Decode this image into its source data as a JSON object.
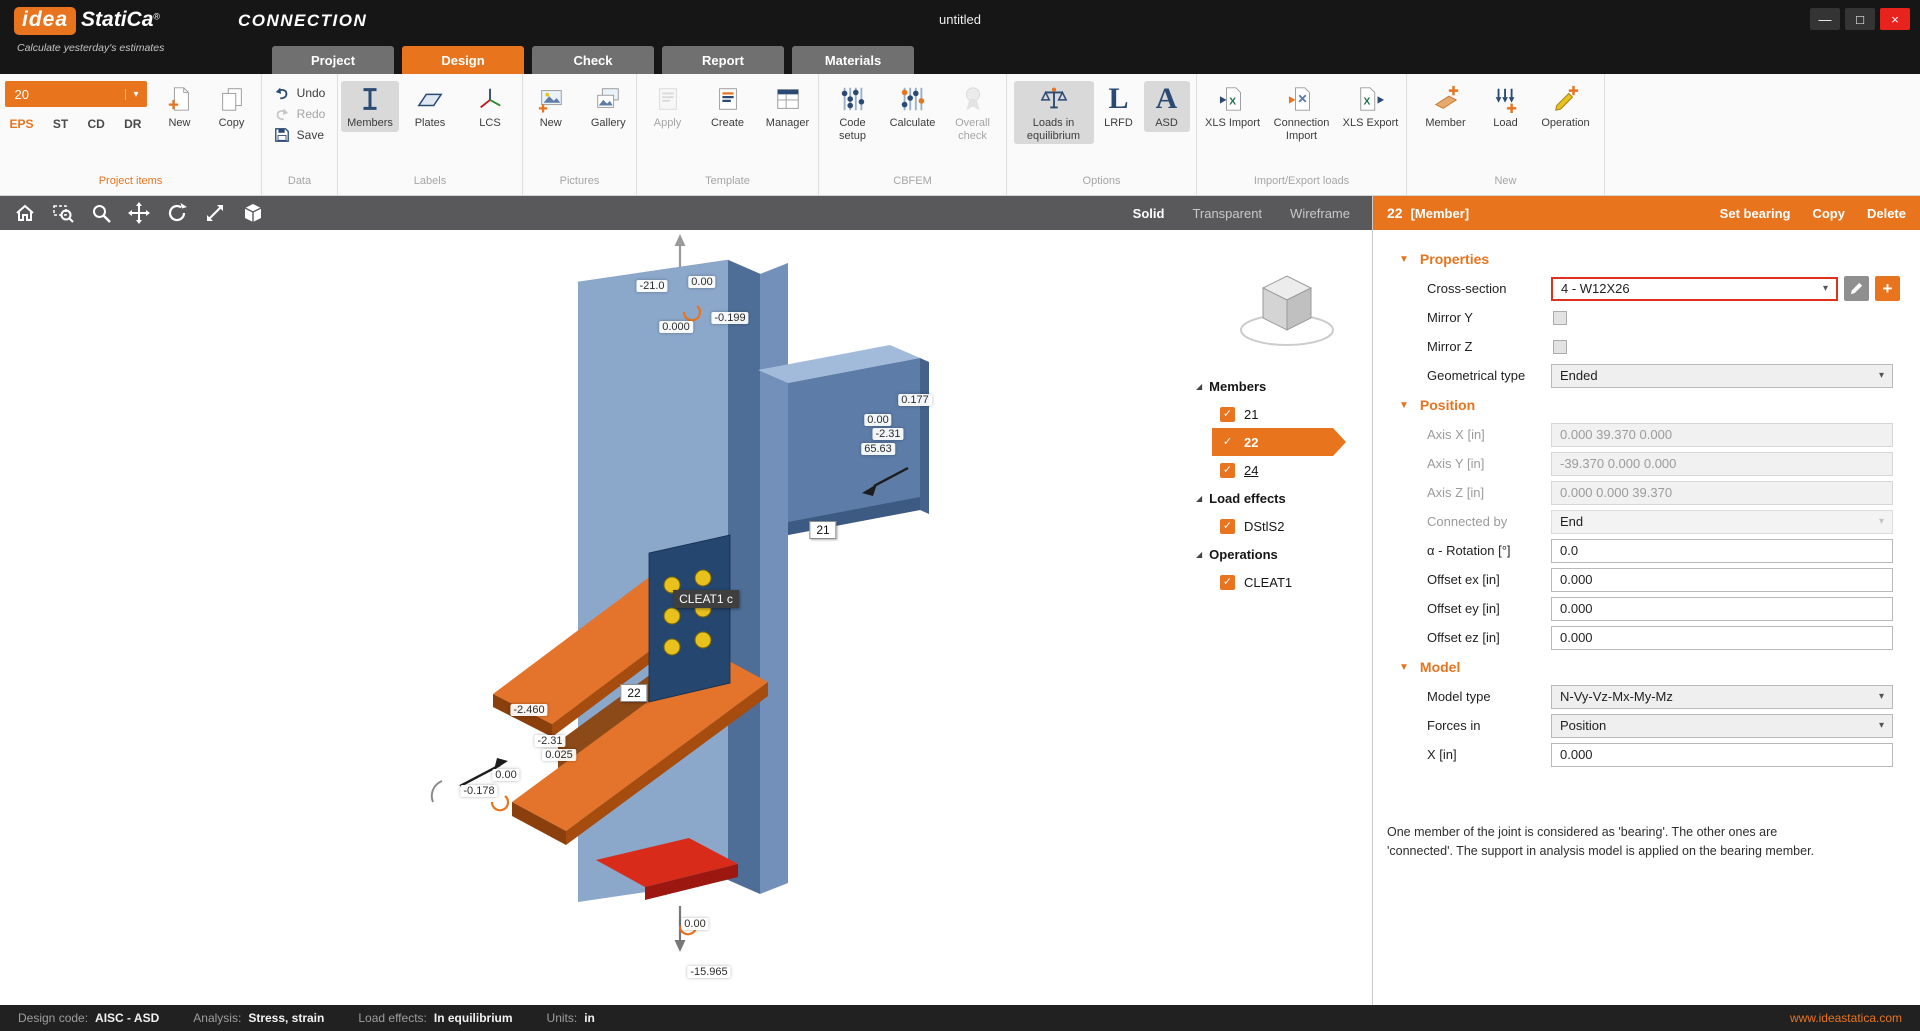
{
  "icons": {
    "check": "✓",
    "expander": "◢",
    "chevron": "▾",
    "section_arrow": "▼",
    "plus": "+",
    "minimize": "—",
    "maximize": "□",
    "close": "×"
  },
  "titlebar": {
    "logo_idea": "idea",
    "logo_statica": "StatiCa",
    "logo_reg": "®",
    "app_name": "CONNECTION",
    "tagline": "Calculate yesterday's estimates",
    "document_title": "untitled"
  },
  "tabs": [
    {
      "label": "Project"
    },
    {
      "label": "Design"
    },
    {
      "label": "Check"
    },
    {
      "label": "Report"
    },
    {
      "label": "Materials"
    }
  ],
  "ribbon": {
    "project_items": {
      "group_label": "Project items",
      "selector_value": "20",
      "codes": [
        "EPS",
        "ST",
        "CD",
        "DR"
      ],
      "new_label": "New",
      "copy_label": "Copy"
    },
    "data": {
      "group_label": "Data",
      "undo": "Undo",
      "redo": "Redo",
      "save": "Save"
    },
    "labels": {
      "group_label": "Labels",
      "members": "Members",
      "plates": "Plates",
      "lcs": "LCS"
    },
    "pictures": {
      "group_label": "Pictures",
      "new": "New",
      "gallery": "Gallery"
    },
    "template": {
      "group_label": "Template",
      "apply": "Apply",
      "create": "Create",
      "manager": "Manager"
    },
    "cbfem": {
      "group_label": "CBFEM",
      "code_setup": "Code setup",
      "calculate": "Calculate",
      "overall_check": "Overall check"
    },
    "options": {
      "group_label": "Options",
      "loads_eq": "Loads in equilibrium",
      "lrfd_letter": "L",
      "lrfd": "LRFD",
      "asd_letter": "A",
      "asd": "ASD"
    },
    "import_export": {
      "group_label": "Import/Export loads",
      "xls_import": "XLS Import",
      "connection_import": "Connection Import",
      "xls_export": "XLS Export"
    },
    "new": {
      "group_label": "New",
      "member": "Member",
      "load": "Load",
      "operation": "Operation"
    }
  },
  "viewport": {
    "toolbar_modes": [
      {
        "label": "Solid"
      },
      {
        "label": "Transparent"
      },
      {
        "label": "Wireframe"
      }
    ],
    "member_tags": {
      "m21": "21",
      "m22": "22",
      "cleat": "CLEAT1 c"
    },
    "dims": {
      "d1": "-21.0",
      "d2": "0.00",
      "d3": "0.000",
      "d4": "-0.199",
      "d5": "0.177",
      "d6": "0.00",
      "d7": "-2.31",
      "d8": "65.63",
      "d9": "-2.460",
      "d10": "-2.31",
      "d11": "0.025",
      "d12": "0.00",
      "d13": "-0.178",
      "d14": "0.00",
      "d15": "-15.965"
    }
  },
  "tree": {
    "members": {
      "header": "Members",
      "items": [
        {
          "label": "21"
        },
        {
          "label": "22"
        },
        {
          "label": "24"
        }
      ]
    },
    "load_effects": {
      "header": "Load effects",
      "items": [
        {
          "label": "DStlS2"
        }
      ]
    },
    "operations": {
      "header": "Operations",
      "items": [
        {
          "label": "CLEAT1"
        }
      ]
    }
  },
  "panel": {
    "header": {
      "id": "22",
      "type": "[Member]",
      "actions": [
        "Set bearing",
        "Copy",
        "Delete"
      ]
    },
    "sections": {
      "properties": {
        "title": "Properties",
        "cross_section": {
          "label": "Cross-section",
          "value": "4 - W12X26"
        },
        "mirror_y": {
          "label": "Mirror Y"
        },
        "mirror_z": {
          "label": "Mirror Z"
        },
        "geometrical_type": {
          "label": "Geometrical type",
          "value": "Ended"
        }
      },
      "position": {
        "title": "Position",
        "axis_x": {
          "label": "Axis X [in]",
          "value": "0.000 39.370 0.000"
        },
        "axis_y": {
          "label": "Axis Y [in]",
          "value": "-39.370 0.000 0.000"
        },
        "axis_z": {
          "label": "Axis Z [in]",
          "value": "0.000 0.000 39.370"
        },
        "connected_by": {
          "label": "Connected by",
          "value": "End"
        },
        "rotation": {
          "label": "α - Rotation [°]",
          "value": "0.0"
        },
        "offset_ex": {
          "label": "Offset ex [in]",
          "value": "0.000"
        },
        "offset_ey": {
          "label": "Offset ey [in]",
          "value": "0.000"
        },
        "offset_ez": {
          "label": "Offset ez [in]",
          "value": "0.000"
        }
      },
      "model": {
        "title": "Model",
        "model_type": {
          "label": "Model type",
          "value": "N-Vy-Vz-Mx-My-Mz"
        },
        "forces_in": {
          "label": "Forces in",
          "value": "Position"
        },
        "x": {
          "label": "X [in]",
          "value": "0.000"
        }
      }
    },
    "help_text": "One member of the joint is considered as 'bearing'. The other ones are 'connected'. The support in analysis model is applied on the bearing member."
  },
  "statusbar": {
    "design_code_label": "Design code:",
    "design_code_value": "AISC - ASD",
    "analysis_label": "Analysis:",
    "analysis_value": "Stress, strain",
    "load_effects_label": "Load effects:",
    "load_effects_value": "In equilibrium",
    "units_label": "Units:",
    "units_value": "in",
    "website": "www.ideastatica.com"
  },
  "colors": {
    "accent": "#e8741e",
    "selection_red": "#e0301e",
    "steel_blue": "#8ba7ca",
    "steel_orange": "#e4742b",
    "bearing_red": "#d82b1a",
    "bolt_yellow": "#e8c11d"
  }
}
